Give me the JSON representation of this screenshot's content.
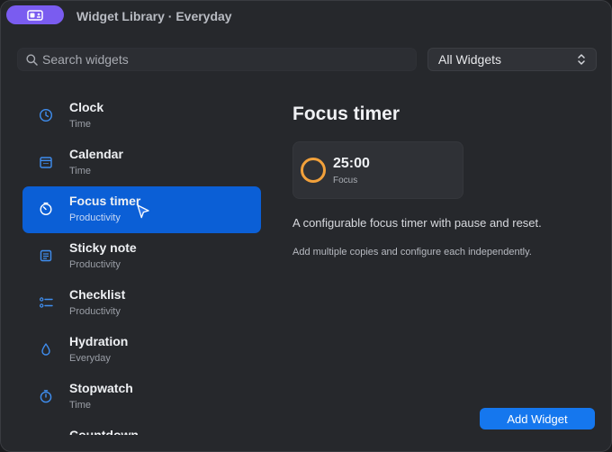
{
  "window": {
    "title": "Widget Library · Everyday"
  },
  "search": {
    "placeholder": "Search widgets",
    "icon": "search-icon"
  },
  "filter": {
    "value": "All Widgets",
    "icon": "chevron-up-down-icon"
  },
  "widgets": [
    {
      "name": "Clock",
      "category": "Time",
      "icon": "clock-icon",
      "selected": false
    },
    {
      "name": "Calendar",
      "category": "Time",
      "icon": "calendar-icon",
      "selected": false
    },
    {
      "name": "Focus timer",
      "category": "Productivity",
      "icon": "timer-icon",
      "selected": true
    },
    {
      "name": "Sticky note",
      "category": "Productivity",
      "icon": "note-icon",
      "selected": false
    },
    {
      "name": "Checklist",
      "category": "Productivity",
      "icon": "checklist-icon",
      "selected": false
    },
    {
      "name": "Hydration",
      "category": "Everyday",
      "icon": "water-drop-icon",
      "selected": false
    },
    {
      "name": "Stopwatch",
      "category": "Time",
      "icon": "stopwatch-icon",
      "selected": false
    },
    {
      "name": "Countdown",
      "category": "",
      "icon": "",
      "selected": false
    }
  ],
  "detail": {
    "title": "Focus timer",
    "preview": {
      "time": "25:00",
      "label": "Focus"
    },
    "description": "A configurable focus timer with pause and reset.",
    "note": "Add multiple copies and configure each independently."
  },
  "actions": {
    "add_label": "Add Widget"
  },
  "colors": {
    "accent": "#0b5fd6",
    "button": "#1577ee",
    "app_pill": "#7a5cf0",
    "timer_ring": "#f2a13b",
    "icon_blue": "#3f8ef0"
  }
}
